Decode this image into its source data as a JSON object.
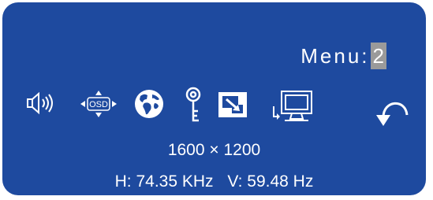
{
  "menu": {
    "label": "Menu:",
    "number": "2"
  },
  "icons": [
    {
      "name": "volume-icon"
    },
    {
      "name": "osd-position-icon",
      "text": "OSD"
    },
    {
      "name": "language-globe-icon"
    },
    {
      "name": "lock-key-icon"
    },
    {
      "name": "image-position-icon"
    },
    {
      "name": "input-source-icon"
    },
    {
      "name": "return-arrow-icon"
    }
  ],
  "info": {
    "resolution": "1600 × 1200",
    "h_freq": "H: 74.35 KHz",
    "v_freq": "V: 59.48 Hz"
  },
  "colors": {
    "panel_bg": "#1e4a9f",
    "highlight": "#9a9a9a",
    "text": "#ffffff"
  }
}
